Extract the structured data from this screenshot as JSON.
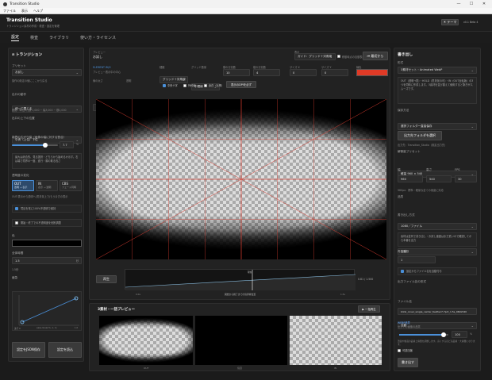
{
  "window": {
    "title": "Transition Studio",
    "menu": [
      "ファイル",
      "表示",
      "ヘルプ"
    ],
    "controls": [
      "minimize",
      "maximize",
      "close"
    ]
  },
  "header": {
    "title": "Transition Studio",
    "subtitle": "トランジション素材の作成・検査・設定を管理",
    "theme_btn": "☀ テーマ",
    "version": "v0.1 Beta 4"
  },
  "tabs": [
    "設定",
    "検査",
    "ライブラリ",
    "使い方・ライセンス"
  ],
  "left": {
    "section_title": "トランジション",
    "preset_label": "プリセット",
    "preset_value": "お試し",
    "preset_note": "操作の既定の値にここから戻る",
    "behavior_label": "出口の動作",
    "behavior_value": "使って閉じる",
    "behavior_note": "根拠：単位1行数 1,000 ~ 幅3,000 ~ 横1,000",
    "direction_label": "出口の上下の位置",
    "direction_value": "中央（上位）下位",
    "depth_label": "境界の広がり幅（画像の幅に対する割合）",
    "depth_value": "7.7",
    "depth_unit": "%",
    "depth_frac": 0.72,
    "info_text": "最大は総合的、見る選択・どちらから始めるか示す。右は端で境界の一度、進行・順の取る長さ",
    "mode_label": "透明度の変化",
    "modes": [
      {
        "title": "OUT",
        "sub": "透明 → 表示"
      },
      {
        "title": "IN",
        "sub": "表示 → 透明"
      },
      {
        "title": "CBS",
        "sub": "フェード同時"
      }
    ],
    "mode_note": "OUT:表示から透明へ(黒背景上で)もう片方の表示",
    "check1": "境目を常に100%不透明で維持",
    "check2": "開始・終了での不透明度を個別調整",
    "color_label": "色",
    "time_label": "全体時間",
    "time_value": "1.5",
    "time_unit": "秒",
    "time_note": "1.5秒",
    "easing_label": "緩急",
    "easing_value": "一定",
    "graph_start": "進行 0",
    "graph_mid": "ease-linear(%, 1, 1)",
    "graph_end": "1.0",
    "save_btn": "設定をJSON保存",
    "load_btn": "設定を読込"
  },
  "preview": {
    "caption": "プレビュー",
    "preset_name": "お試し",
    "elem_label": "ELEMENT W/H",
    "elem_sub": "プレビュー表示中の中心",
    "view_label": "表示",
    "view_value": "ガイド：グリッド＋対角線",
    "guide_check": "移動時点の自動表示",
    "restart_btn": "⏮ 最初から",
    "row1": [
      {
        "label": "種類",
        "value": "グリッド＋対角線"
      },
      {
        "label": "グリッド数量",
        "value": "中間線"
      },
      {
        "label": "横の分割数",
        "value": "10"
      },
      {
        "label": "縦の分割数",
        "value": "4"
      },
      {
        "label": "サイズ X",
        "value": "0"
      },
      {
        "label": "サイズ Y",
        "value": "0"
      },
      {
        "label": "線色",
        "value": ""
      }
    ],
    "row2": [
      {
        "label": "線の太さ",
        "value": "15"
      },
      {
        "label": "透明",
        "value": "2"
      }
    ],
    "checks": [
      "中央十字",
      "外枠線",
      "余白（比率）"
    ],
    "preset_btn": "表示のDPIを必ず",
    "play_btn": "再生",
    "timeline_tip": "現在",
    "tl_start": "0.0s",
    "tl_mid": "開始から終了までの境界線位置",
    "tl_end": "1.5s",
    "tl_time": "0.81 / 1.500"
  },
  "thumbs": {
    "title": "3素材・一括プレビュー",
    "btn": "▶ 一括再生",
    "labels": [
      "OUT",
      "境目",
      "IN"
    ]
  },
  "right": {
    "title": "書き出し",
    "format_label": "形式",
    "format_value": "3素材セット・Animated WebP",
    "format_note": "OUT（透明→表）・HOLD（黒背景の可）・IN（OUT反転版）の3つを同時に作成します。3素材を並び替えて使用すると繋ぎがスムーズです。",
    "folder_label": "保存方法",
    "folder_value": "選択フォルダー直接保存",
    "folder_btn": "出力先フォルダを選択",
    "folder_note": "出力先：Transition_Studio（既定出力先）",
    "res_label": "解像度プリセット",
    "res_value": "軽量 960 × 540",
    "w_label": "幅",
    "w_value": "960",
    "h_label": "高さ",
    "h_value": "540",
    "fps_label": "FPS",
    "fps_value": "30",
    "res_note": "960px：標準・軽量な全ての用途に対応",
    "quality_label": "品質",
    "quality_value": "1080／ファイル",
    "sync_label": "書き出し方式",
    "sync_value": "自動",
    "sync_note": "素材は並列で書き出し・お試し速度はまだ低いので確認してから本番を出力",
    "delay_label": "再生回数",
    "delay_value": "1",
    "chk": "設定からファイル名を自動付与",
    "name_label": "出力ファイル名の形式",
    "name_value": "自動",
    "file_label": "ファイル名",
    "file_value": "blink_cover_single_center_feather7.7pct_1.5s_960x540",
    "webp_label": "WEBP品質",
    "webp_sub": "セットの画像の品質",
    "webp_value": "100",
    "webp_unit": "%",
    "webp_frac": 0.9,
    "webp_note": "透過や動画の品質と容量を調整します。高くするほど高品質・大容量になります。",
    "lossless": "可逆圧縮",
    "export_btn": "書き出す"
  },
  "colors": {
    "accent": "#4a90d9",
    "swatch": "#e03a26",
    "guide": "#d33a2e"
  }
}
